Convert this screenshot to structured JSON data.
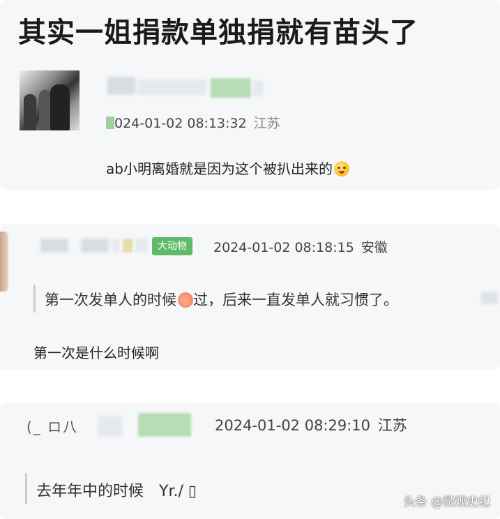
{
  "post": {
    "title": "其实一姐捐款单独捐就有苗头了"
  },
  "comment1": {
    "timestamp": "024-01-02 08:13:32",
    "location": "江苏",
    "text": "ab小明离婚就是因为这个被扒出来的"
  },
  "comment2": {
    "badge": "大动物",
    "timestamp": "2024-01-02 08:18:15",
    "location": "安徽",
    "quote_before": "第一次发单人的时候",
    "quote_after": "过，后来一直发单人就习惯了。",
    "reply": "第一次是什么时候啊"
  },
  "comment3": {
    "name_fragment": "(_ ロ八",
    "timestamp": "2024-01-02 08:29:10",
    "location": "江苏",
    "quote": "去年年中的时候　Yr./ ▯"
  },
  "watermark": "头条 @微观史纪",
  "icons": [
    "avatar-photo",
    "face-emoji-icon",
    "peach-emoji-icon"
  ]
}
